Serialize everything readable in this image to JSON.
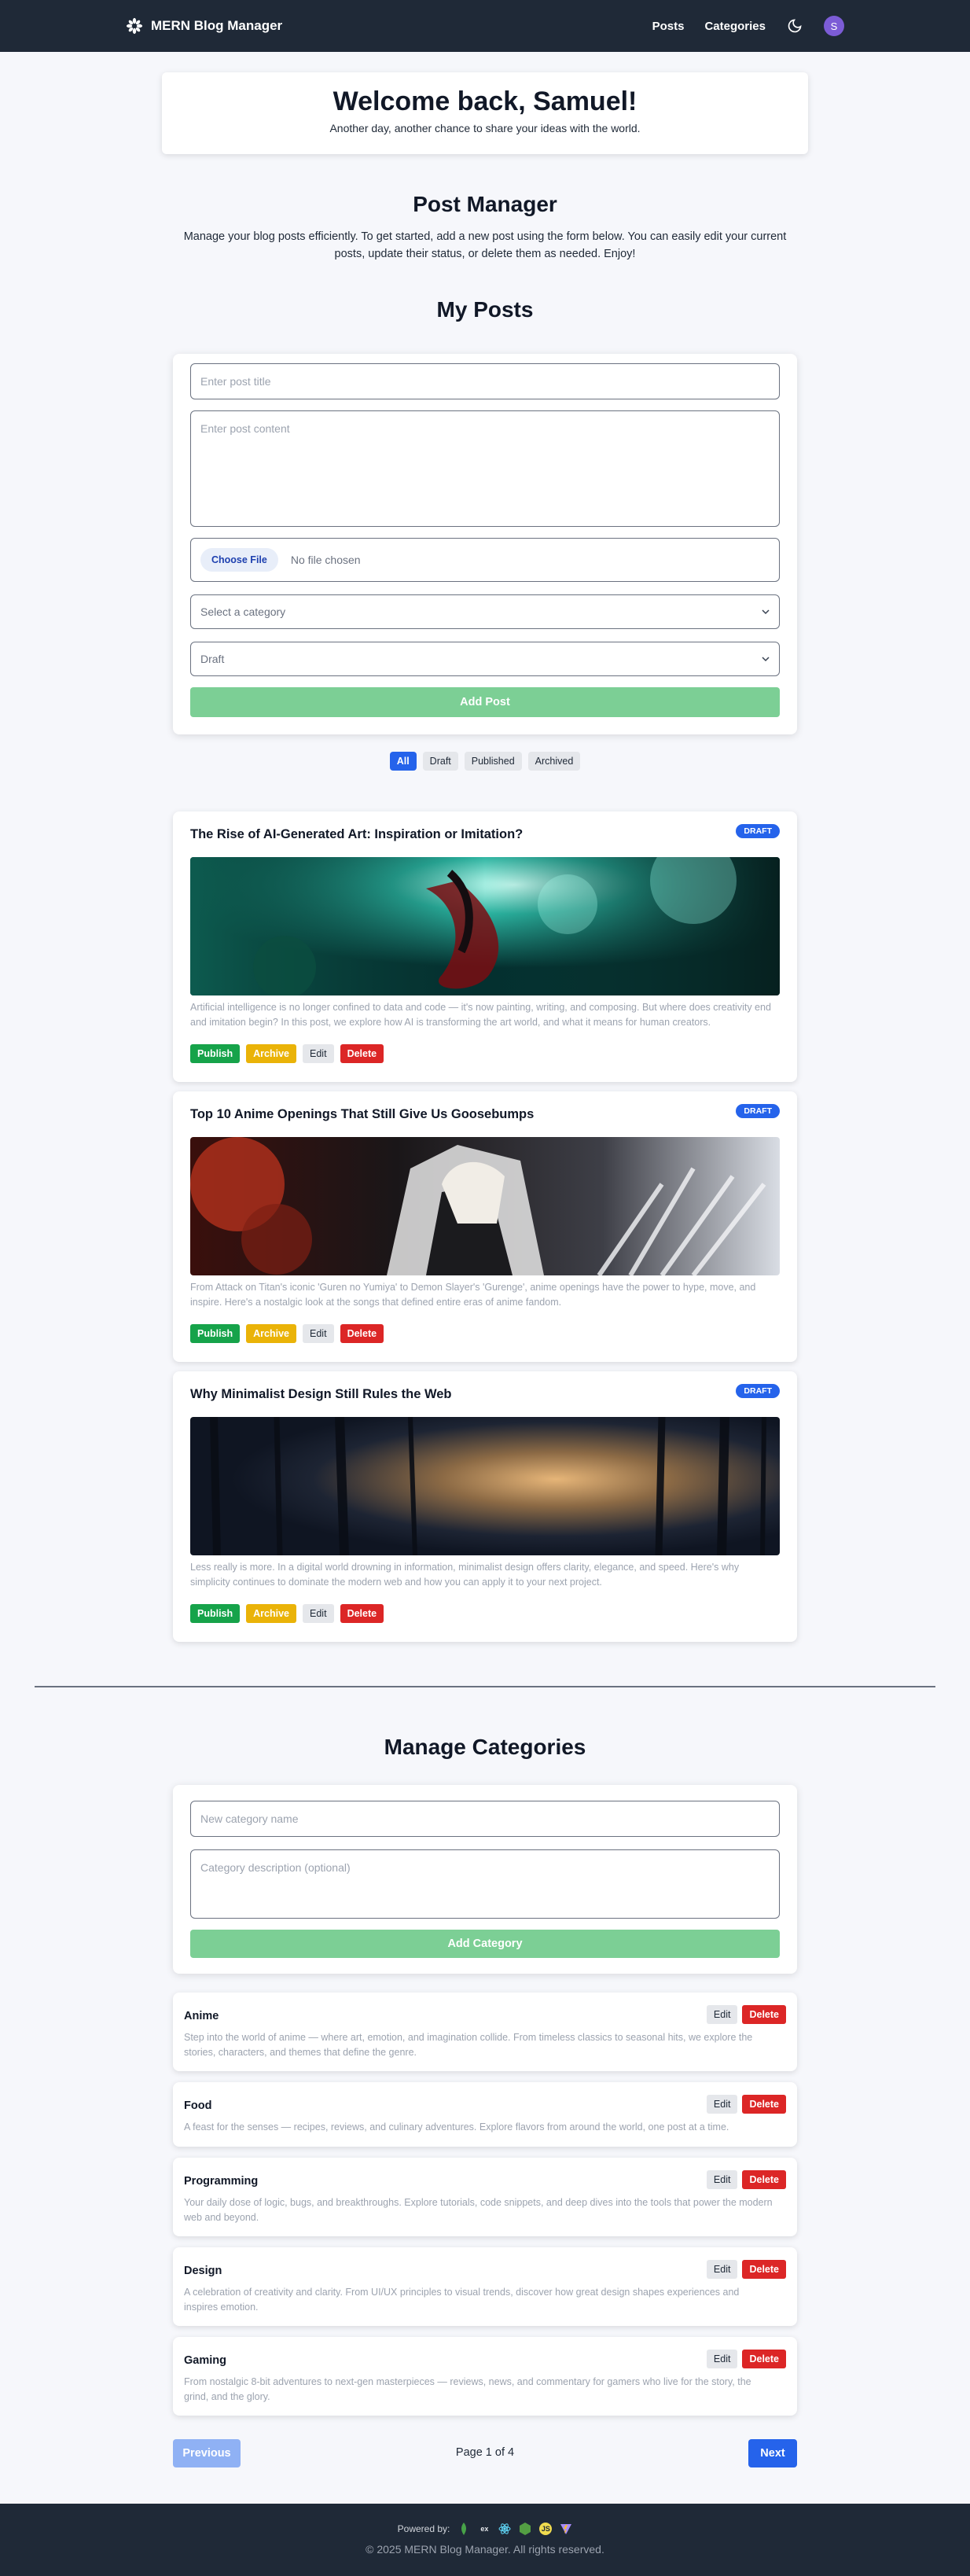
{
  "app": {
    "brand": "MERN Blog Manager"
  },
  "nav": {
    "posts": "Posts",
    "categories": "Categories",
    "avatar_initial": "S"
  },
  "welcome": {
    "title": "Welcome back, Samuel!",
    "subtitle": "Another day, another chance to share your ideas with the world."
  },
  "post_manager": {
    "title": "Post Manager",
    "description": "Manage your blog posts efficiently. To get started, add a new post using the form below. You can easily edit your current posts, update their status, or delete them as needed. Enjoy!",
    "my_posts_title": "My Posts"
  },
  "post_form": {
    "title_placeholder": "Enter post title",
    "content_placeholder": "Enter post content",
    "choose_file": "Choose File",
    "no_file": "No file chosen",
    "category_select": "Select a category",
    "status_select": "Draft",
    "submit": "Add Post"
  },
  "filters": [
    "All",
    "Draft",
    "Published",
    "Archived"
  ],
  "post_actions": {
    "publish": "Publish",
    "archive": "Archive",
    "edit": "Edit",
    "delete": "Delete"
  },
  "posts": [
    {
      "title": "The Rise of AI-Generated Art: Inspiration or Imitation?",
      "status": "DRAFT",
      "excerpt": "Artificial intelligence is no longer confined to data and code — it's now painting, writing, and composing. But where does creativity end and imitation begin? In this post, we explore how AI is transforming the art world, and what it means for human creators."
    },
    {
      "title": "Top 10 Anime Openings That Still Give Us Goosebumps",
      "status": "DRAFT",
      "excerpt": "From Attack on Titan's iconic 'Guren no Yumiya' to Demon Slayer's 'Gurenge', anime openings have the power to hype, move, and inspire. Here's a nostalgic look at the songs that defined entire eras of anime fandom."
    },
    {
      "title": "Why Minimalist Design Still Rules the Web",
      "status": "DRAFT",
      "excerpt": "Less really is more. In a digital world drowning in information, minimalist design offers clarity, elegance, and speed. Here's why simplicity continues to dominate the modern web and how you can apply it to your next project."
    }
  ],
  "categories_section": {
    "title": "Manage Categories",
    "name_placeholder": "New category name",
    "desc_placeholder": "Category description (optional)",
    "submit": "Add Category",
    "edit": "Edit",
    "delete": "Delete"
  },
  "categories": [
    {
      "name": "Anime",
      "description": "Step into the world of anime — where art, emotion, and imagination collide. From timeless classics to seasonal hits, we explore the stories, characters, and themes that define the genre."
    },
    {
      "name": "Food",
      "description": "A feast for the senses — recipes, reviews, and culinary adventures. Explore flavors from around the world, one post at a time."
    },
    {
      "name": "Programming",
      "description": "Your daily dose of logic, bugs, and breakthroughs. Explore tutorials, code snippets, and deep dives into the tools that power the modern web and beyond."
    },
    {
      "name": "Design",
      "description": "A celebration of creativity and clarity. From UI/UX principles to visual trends, discover how great design shapes experiences and inspires emotion."
    },
    {
      "name": "Gaming",
      "description": "From nostalgic 8-bit adventures to next-gen masterpieces — reviews, news, and commentary for gamers who live for the story, the grind, and the glory."
    }
  ],
  "pagination": {
    "previous": "Previous",
    "page_label": "Page 1 of 4",
    "next": "Next"
  },
  "footer": {
    "powered_by": "Powered by:",
    "copyright": "© 2025 MERN Blog Manager. All rights reserved."
  },
  "colors": {
    "navbar": "#1f2937",
    "primary": "#2563eb",
    "success": "#16a34a",
    "warning": "#eab308",
    "danger": "#dc2626",
    "submit_disabled": "#7ccf95"
  }
}
